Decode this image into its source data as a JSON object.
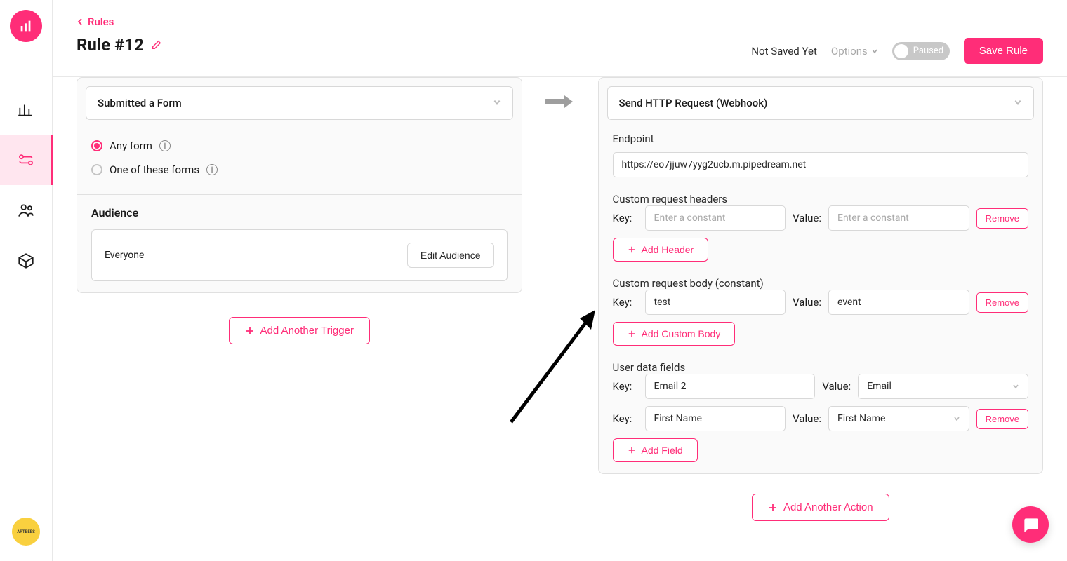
{
  "breadcrumb": {
    "label": "Rules"
  },
  "page": {
    "title": "Rule #12"
  },
  "header": {
    "status": "Not Saved Yet",
    "options_label": "Options",
    "toggle_label": "Paused",
    "save_label": "Save Rule"
  },
  "trigger": {
    "select_label": "Submitted a Form",
    "radios": {
      "any": "Any form",
      "one_of": "One of these forms"
    },
    "audience_title": "Audience",
    "audience_value": "Everyone",
    "edit_audience": "Edit Audience",
    "add_trigger": "Add Another Trigger"
  },
  "action": {
    "select_label": "Send HTTP Request (Webhook)",
    "endpoint_label": "Endpoint",
    "endpoint_value": "https://eo7jjuw7yyg2ucb.m.pipedream.net",
    "headers_title": "Custom request headers",
    "key_label": "Key:",
    "value_label": "Value:",
    "header_key_placeholder": "Enter a constant",
    "header_value_placeholder": "Enter a constant",
    "remove": "Remove",
    "add_header": "Add Header",
    "body_title": "Custom request body (constant)",
    "body_rows": [
      {
        "key": "test",
        "value": "event"
      }
    ],
    "add_body": "Add Custom Body",
    "user_fields_title": "User data fields",
    "user_rows": [
      {
        "key": "Email 2",
        "value": "Email"
      },
      {
        "key": "First Name",
        "value": "First Name"
      }
    ],
    "add_field": "Add Field",
    "add_action": "Add Another Action"
  },
  "avatar_text": "ARTBEES"
}
